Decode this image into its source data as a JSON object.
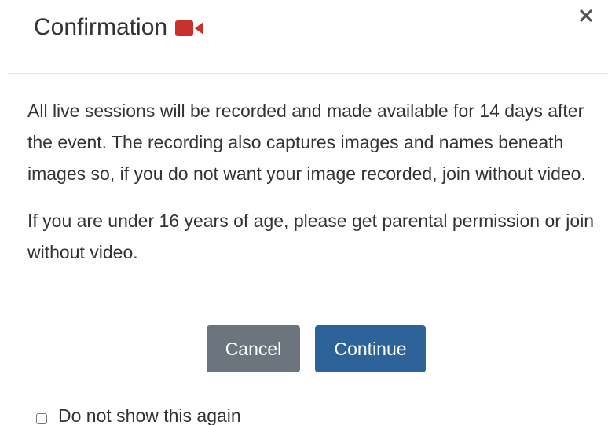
{
  "dialog": {
    "title": "Confirmation",
    "title_icon": "video-camera-icon",
    "close_icon": "close-icon",
    "paragraphs": [
      "All live sessions will be recorded and made available for 14 days after the event. The recording also captures images and names beneath images so, if you do not want your image recorded, join without video.",
      "If you are under 16 years of age, please get parental permission or join without video."
    ],
    "buttons": {
      "cancel_label": "Cancel",
      "continue_label": "Continue"
    },
    "dont_show_label": "Do not show this again",
    "dont_show_checked": false
  },
  "colors": {
    "icon_red": "#c9302c",
    "cancel_bg": "#6c757d",
    "continue_bg": "#2e6399",
    "text": "#333333"
  }
}
